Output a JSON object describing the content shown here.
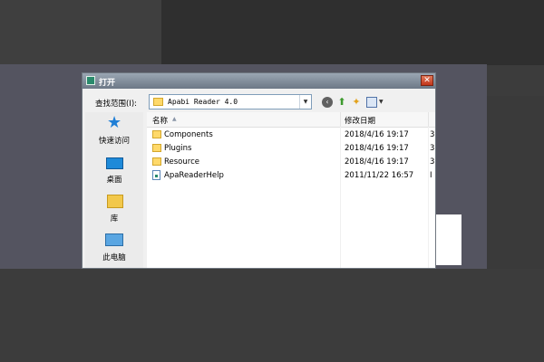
{
  "dialog": {
    "title": "打开",
    "close_symbol": "✕"
  },
  "toolbar": {
    "look_in_label": "查找范围(I):",
    "look_in_value": "Apabi Reader 4.0"
  },
  "places": [
    {
      "label": "快速访问",
      "icon": "star-icon"
    },
    {
      "label": "桌面",
      "icon": "desktop-icon"
    },
    {
      "label": "库",
      "icon": "library-icon"
    },
    {
      "label": "此电脑",
      "icon": "computer-icon"
    }
  ],
  "file_list": {
    "columns": {
      "name": "名称",
      "date": "修改日期"
    },
    "rows": [
      {
        "name": "Components",
        "date": "2018/4/16 19:17",
        "extra": "3",
        "type": "folder"
      },
      {
        "name": "Plugins",
        "date": "2018/4/16 19:17",
        "extra": "3",
        "type": "folder"
      },
      {
        "name": "Resource",
        "date": "2018/4/16 19:17",
        "extra": "3",
        "type": "folder"
      },
      {
        "name": "ApaReaderHelp",
        "date": "2011/11/22 16:57",
        "extra": "I",
        "type": "file"
      }
    ]
  }
}
